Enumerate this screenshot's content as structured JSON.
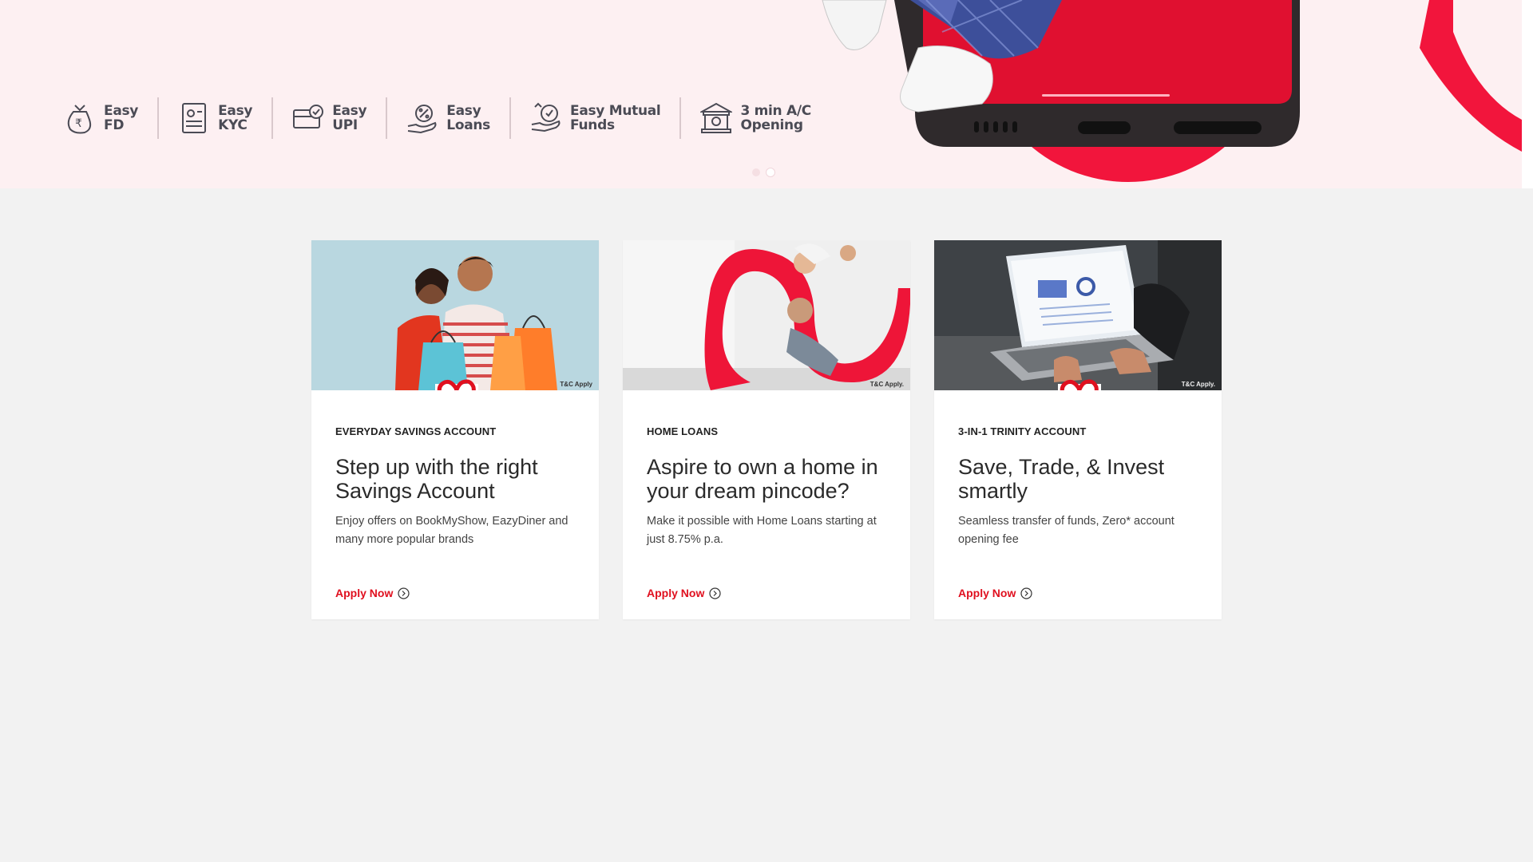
{
  "banner": {
    "features": [
      {
        "icon": "money-bag-rupee-icon",
        "line1": "Easy",
        "line2": "FD"
      },
      {
        "icon": "document-kyc-icon",
        "line1": "Easy",
        "line2": "KYC"
      },
      {
        "icon": "card-check-icon",
        "line1": "Easy",
        "line2": "UPI"
      },
      {
        "icon": "hand-percent-icon",
        "line1": "Easy",
        "line2": "Loans"
      },
      {
        "icon": "coins-growth-icon",
        "line1": "Easy Mutual",
        "line2": "Funds"
      },
      {
        "icon": "bank-building-icon",
        "line1": "3 min A/C",
        "line2": "Opening"
      }
    ],
    "carousel": {
      "slides": 2,
      "active": 2
    }
  },
  "cards": [
    {
      "category": "EVERYDAY SAVINGS ACCOUNT",
      "title": "Step up with the right Savings Account",
      "description": "Enjoy offers on BookMyShow, EazyDiner and many more popular brands",
      "cta": "Apply Now",
      "image_note": "T&C Apply",
      "image": "couple-with-shopping-bags"
    },
    {
      "category": "HOME LOANS",
      "title": "Aspire to own a home in your dream pincode?",
      "description": "Make it possible with Home Loans starting at just 8.75% p.a.",
      "cta": "Apply Now",
      "image_note": "T&C Apply.",
      "image": "family-with-infinity-ribbon"
    },
    {
      "category": "3-IN-1 TRINITY ACCOUNT",
      "title": "Save, Trade, & Invest smartly",
      "description": "Seamless transfer of funds, Zero* account opening fee",
      "cta": "Apply Now",
      "image_note": "T&C Apply.",
      "image": "laptop-dashboard"
    }
  ],
  "colors": {
    "brand_red": "#e0101f",
    "hero_bg": "#fdf0f2",
    "page_bg": "#f2f2f2"
  }
}
